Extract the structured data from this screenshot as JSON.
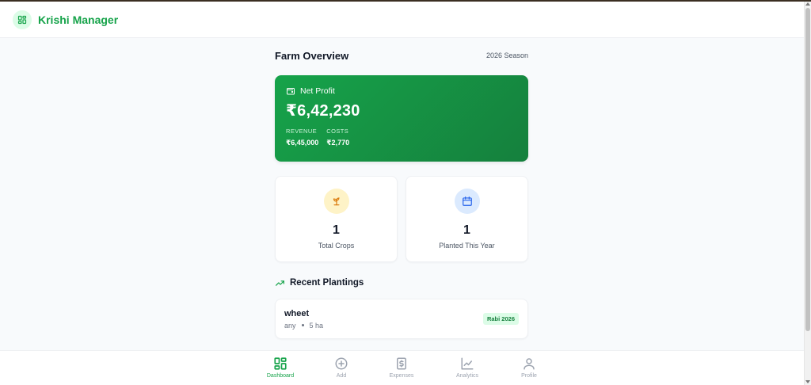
{
  "header": {
    "app_title": "Krishi Manager",
    "logo_icon": "dashboard-grid-icon"
  },
  "overview": {
    "title": "Farm Overview",
    "season": "2026 Season"
  },
  "profit": {
    "label": "Net Profit",
    "amount": "₹6,42,230",
    "revenue_label": "REVENUE",
    "revenue_value": "₹6,45,000",
    "costs_label": "COSTS",
    "costs_value": "₹2,770",
    "icon": "wallet-icon"
  },
  "stats": [
    {
      "value": "1",
      "label": "Total Crops",
      "icon": "sprout-icon"
    },
    {
      "value": "1",
      "label": "Planted This Year",
      "icon": "calendar-icon"
    }
  ],
  "recent": {
    "title": "Recent Plantings",
    "icon": "trending-up-icon",
    "items": [
      {
        "name": "wheet",
        "variety": "any",
        "area": "5 ha",
        "badge": "Rabi 2026"
      }
    ]
  },
  "nav": [
    {
      "label": "Dashboard",
      "icon": "dashboard-icon",
      "active": true
    },
    {
      "label": "Add",
      "icon": "plus-circle-icon",
      "active": false
    },
    {
      "label": "Expenses",
      "icon": "receipt-icon",
      "active": false
    },
    {
      "label": "Analytics",
      "icon": "chart-line-icon",
      "active": false
    },
    {
      "label": "Profile",
      "icon": "user-icon",
      "active": false
    }
  ],
  "colors": {
    "primary": "#16a34a",
    "primary_dark": "#15803d",
    "badge_bg": "#dcfce7",
    "amber_bg": "#fef3c7",
    "blue_bg": "#dbeafe"
  }
}
